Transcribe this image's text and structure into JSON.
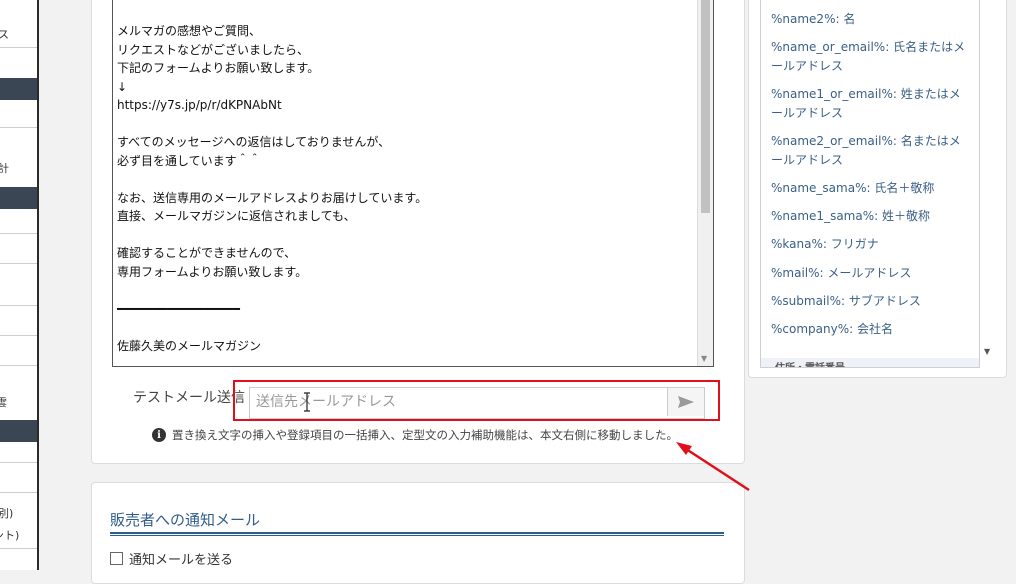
{
  "sidebar": {
    "fragments": [
      "ス",
      "計",
      "雲",
      "別)",
      "ント)"
    ]
  },
  "editor": {
    "body_text": "メルマガの感想やご質問、\nリクエストなどがございましたら、\n下記のフォームよりお願い致します。\n↓\nhttps://y7s.jp/p/r/dKPNAbNt\n\nすべてのメッセージへの返信はしておりませんが、\n必ず目を通しています＾＾\n\nなお、送信専用のメールアドレスよりお届けしています。\n直接、メールマガジンに返信されましても、\n\n確認することができませんので、\n専用フォームよりお願い致します。\n\n━━━━━━━━━━━━━━━━━\n\n佐藤久美のメールマガジン"
  },
  "test_mail": {
    "label": "テストメール送信",
    "placeholder": "送信先メールアドレス",
    "send_icon": "send-arrow-icon"
  },
  "info": {
    "icon": "info-icon",
    "text": "置き換え文字の挿入や登録項目の一括挿入、定型文の入力補助機能は、本文右側に移動しました。"
  },
  "notification": {
    "title": "販売者への通知メール",
    "checkbox_label": "通知メールを送る"
  },
  "placeholders": {
    "items": [
      "%name2%: 名",
      "%name_or_email%: 氏名またはメ\nールアドレス",
      "%name1_or_email%: 姓またはメ\nールアドレス",
      "%name2_or_email%: 名またはメ\nールアドレス",
      "%name_sama%: 氏名＋敬称",
      "%name1_sama%: 姓＋敬称",
      "%kana%: フリガナ",
      "%mail%: メールアドレス",
      "%submail%: サブアドレス",
      "%company%: 会社名"
    ],
    "partial_group": "住所・電話番号"
  },
  "colors": {
    "highlight": "#e0101a",
    "link": "#3a5f86",
    "heading": "#2f5e8e"
  }
}
